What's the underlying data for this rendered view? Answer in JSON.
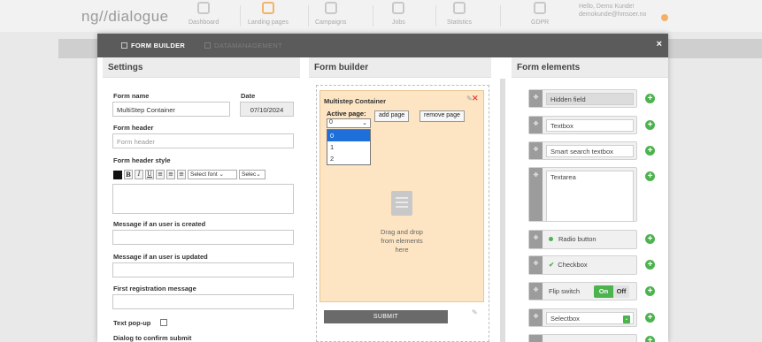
{
  "app": {
    "logo": "ng//dialogue",
    "nav": [
      {
        "label": "Dashboard",
        "icon": "grid-icon"
      },
      {
        "label": "Landing pages",
        "icon": "cart-icon"
      },
      {
        "label": "Campaigns",
        "icon": "megaphone-icon"
      },
      {
        "label": "Jobs",
        "icon": "gears-icon"
      },
      {
        "label": "Statistics",
        "icon": "chart-icon"
      },
      {
        "label": "GDPR",
        "icon": "user-icon"
      }
    ],
    "user": {
      "greeting": "Hello, Demo Kunde!",
      "email": "demokunde@hmsoer.no"
    }
  },
  "modal": {
    "tabs": [
      {
        "label": "FORM BUILDER",
        "active": true
      },
      {
        "label": "DATAMANAGEMENT",
        "active": false
      }
    ],
    "close": "×",
    "columns": {
      "settings": "Settings",
      "builder": "Form builder",
      "elements": "Form elements"
    }
  },
  "settings": {
    "form_name_label": "Form name",
    "form_name_value": "MultiStep Container",
    "date_label": "Date",
    "date_value": "07/10/2024",
    "header_label": "Form header",
    "header_placeholder": "Form header",
    "header_style_label": "Form header style",
    "toolbar": {
      "bold": "B",
      "italic": "I",
      "underline": "U",
      "font_select": "Select font",
      "size_select": "Selec"
    },
    "msg_created_label": "Message if an user is created",
    "msg_updated_label": "Message if an user is updated",
    "first_reg_label": "First registration message",
    "text_popup_label": "Text pop-up",
    "dialog_confirm_label": "Dialog to confirm submit"
  },
  "builder": {
    "container_title": "Multistep Container",
    "active_page_label": "Active page:",
    "selected_page": "0",
    "page_options": [
      "0",
      "1",
      "2"
    ],
    "add_page": "add page",
    "remove_page": "remove page",
    "drop_text_1": "Drag and drop",
    "drop_text_2": "from elements",
    "drop_text_3": "here",
    "submit": "SUBMIT"
  },
  "elements": [
    {
      "label": "Hidden field"
    },
    {
      "label": "Textbox"
    },
    {
      "label": "Smart search textbox"
    },
    {
      "label": "Textarea"
    },
    {
      "label": "Radio button"
    },
    {
      "label": "Checkbox"
    },
    {
      "label": "Flip switch",
      "on": "On",
      "off": "Off"
    },
    {
      "label": "Selectbox"
    }
  ]
}
